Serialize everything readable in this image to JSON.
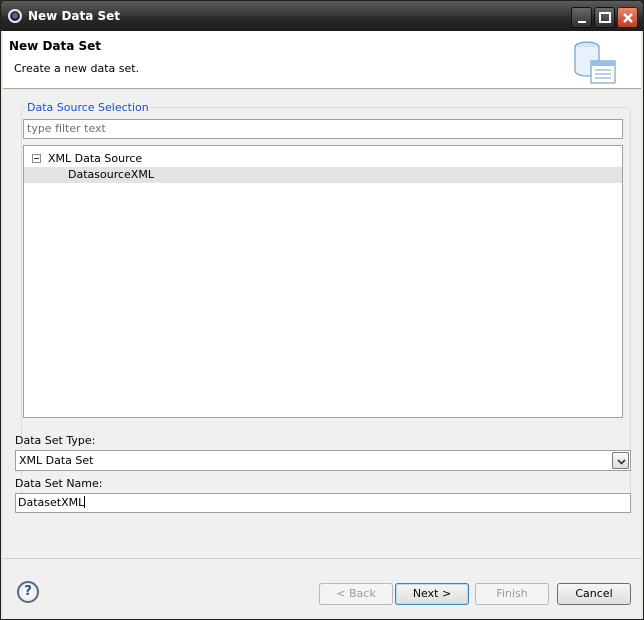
{
  "window": {
    "title": "New Data Set"
  },
  "banner": {
    "heading": "New Data Set",
    "description": "Create a new data set."
  },
  "data_source_selection": {
    "legend": "Data Source Selection",
    "filter_placeholder": "type filter text",
    "tree": [
      {
        "label": "XML Data Source",
        "expanded": true
      },
      {
        "label": "DatasourceXML",
        "selected": true
      }
    ]
  },
  "data_set_type": {
    "label": "Data Set Type:",
    "value": "XML Data Set"
  },
  "data_set_name": {
    "label": "Data Set Name:",
    "value": "DatasetXML"
  },
  "buttons": {
    "back": "< Back",
    "next": "Next >",
    "finish": "Finish",
    "cancel": "Cancel"
  },
  "help": {
    "glyph": "?"
  },
  "colors": {
    "legend": "#1f4fbf",
    "selection": "#e3e3e3",
    "titlebar": "#2a2a2a"
  }
}
